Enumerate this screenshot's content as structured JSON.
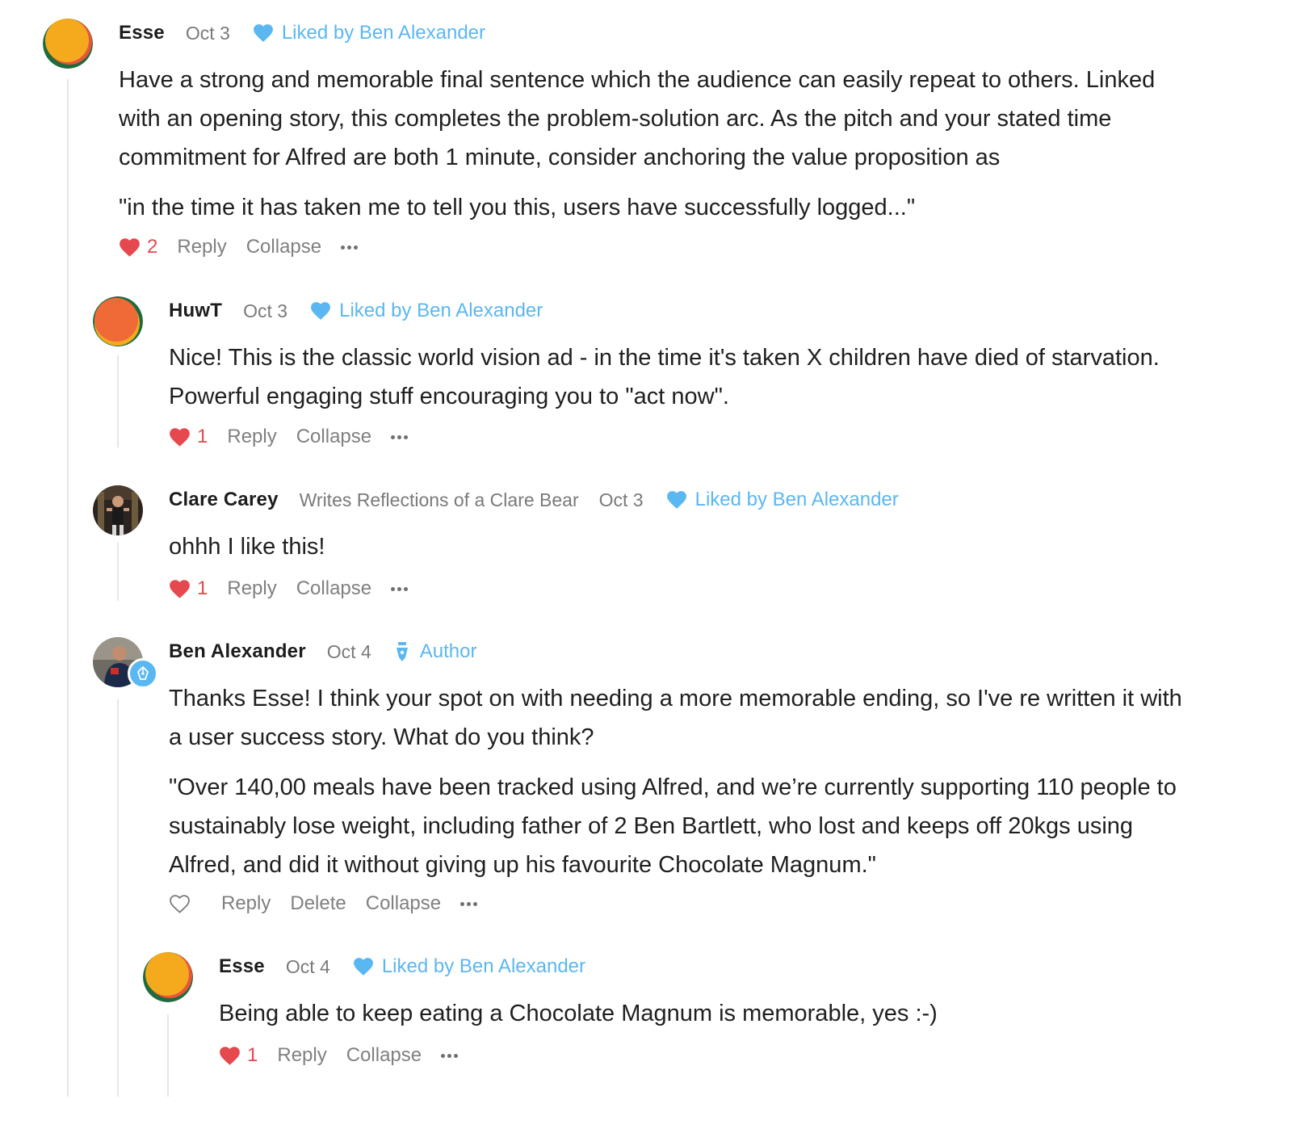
{
  "comments": [
    {
      "author": "Esse",
      "date": "Oct 3",
      "liked_by": "Liked by Ben Alexander",
      "paragraphs": [
        "Have a strong and memorable final sentence which the audience can easily repeat to others. Linked with an opening story, this completes the problem-solution arc. As the pitch and your stated time commitment for Alfred are both 1 minute, consider anchoring the value proposition as",
        "\"in the time it has taken me to tell you this, users have successfully logged...\""
      ],
      "like_count": "2",
      "reply": "Reply",
      "collapse": "Collapse"
    },
    {
      "author": "HuwT",
      "date": "Oct 3",
      "liked_by": "Liked by Ben Alexander",
      "paragraphs": [
        "Nice! This is the classic world vision ad - in the time it's taken X children have died of starvation. Powerful engaging stuff encouraging you to \"act now\"."
      ],
      "like_count": "1",
      "reply": "Reply",
      "collapse": "Collapse"
    },
    {
      "author": "Clare Carey",
      "subtitle": "Writes Reflections of a Clare Bear",
      "date": "Oct 3",
      "liked_by": "Liked by Ben Alexander",
      "paragraphs": [
        "ohhh I like this!"
      ],
      "like_count": "1",
      "reply": "Reply",
      "collapse": "Collapse"
    },
    {
      "author": "Ben Alexander",
      "date": "Oct 4",
      "author_tag": "Author",
      "paragraphs": [
        "Thanks Esse! I think your spot on with needing a more memorable ending, so I've re written it with a user success story. What do you think?",
        "\"Over 140,00 meals have been tracked using Alfred, and we’re currently supporting 110 people to sustainably lose weight, including father of 2 Ben Bartlett, who lost and keeps off 20kgs using Alfred, and did it without giving up his favourite Chocolate Magnum.\""
      ],
      "reply": "Reply",
      "delete": "Delete",
      "collapse": "Collapse"
    },
    {
      "author": "Esse",
      "date": "Oct 4",
      "liked_by": "Liked by Ben Alexander",
      "paragraphs": [
        "Being able to keep eating a Chocolate Magnum is memorable, yes :-)"
      ],
      "like_count": "1",
      "reply": "Reply",
      "collapse": "Collapse"
    }
  ],
  "colors": {
    "accent_blue": "#5bb7f1",
    "heart_red": "#e5484d",
    "muted_text": "#7a7a7a",
    "thread_line": "#e6e6e6"
  },
  "icons": [
    "heart-filled-icon",
    "heart-outline-icon",
    "more-dots-icon",
    "pen-nib-icon"
  ]
}
